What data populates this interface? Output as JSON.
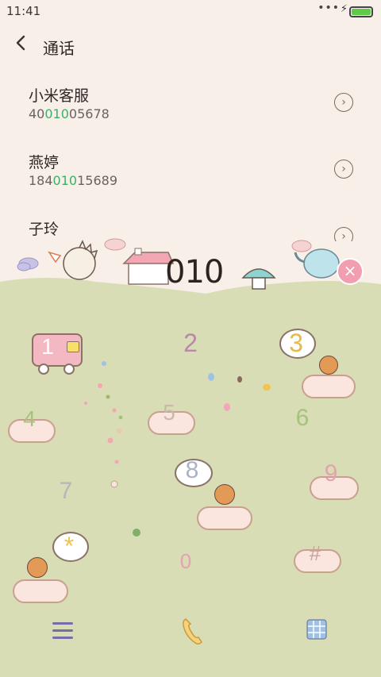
{
  "status_bar": {
    "time": "11:41",
    "more_icon": "more-dots-icon",
    "battery_color": "#5fc94a"
  },
  "header": {
    "title": "通话",
    "back_icon": "chevron-left-icon"
  },
  "results": [
    {
      "name": "小米客服",
      "number_pre": "40",
      "number_match": "010",
      "number_post": "05678"
    },
    {
      "name": "燕婷",
      "number_pre": "184",
      "number_match": "010",
      "number_post": "15689"
    },
    {
      "name": "子玲"
    }
  ],
  "dialer": {
    "input": "010",
    "keys": [
      "1",
      "2",
      "3",
      "4",
      "5",
      "6",
      "7",
      "8",
      "9",
      "*",
      "0",
      "#"
    ]
  },
  "colors": {
    "match": "#3fae6a",
    "hill": "#d8ddb6",
    "background": "#f7efe8"
  }
}
